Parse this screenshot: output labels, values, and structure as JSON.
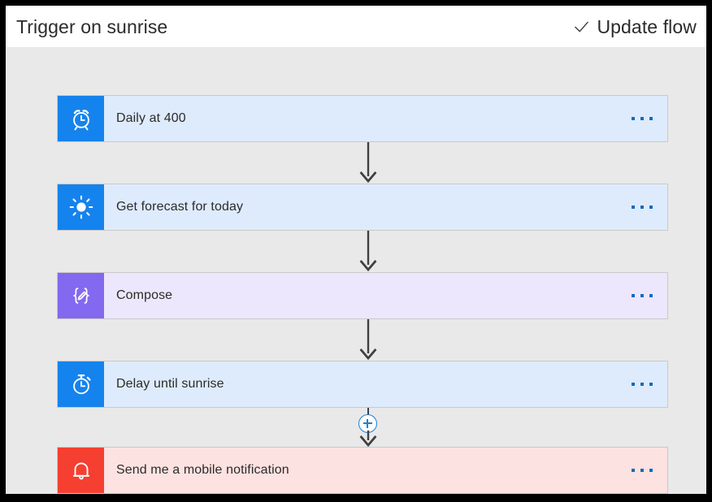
{
  "header": {
    "title": "Trigger on sunrise",
    "update_flow_label": "Update flow",
    "check_icon": "check-icon"
  },
  "colors": {
    "canvas_bg": "#e9e9e9",
    "header_bg": "#ffffff",
    "frame": "#000000",
    "card_blue_bg": "#deebfc",
    "card_blue_icon": "#1583ed",
    "card_purple_bg": "#ede7fd",
    "card_purple_icon": "#8269ef",
    "card_red_bg": "#fce2e0",
    "card_red_icon": "#f43f31",
    "card_border": "#c9c9c9",
    "connector": "#404040",
    "accent_blue": "#0f6cbd",
    "add_button_blue": "#1b7fd6",
    "text": "#2b2b2b"
  },
  "flow": {
    "steps": [
      {
        "title": "Daily at 400",
        "icon": "alarm-clock-icon",
        "theme": "blue",
        "menu_label": "..."
      },
      {
        "title": "Get forecast for today",
        "icon": "sun-icon",
        "theme": "blue",
        "menu_label": "..."
      },
      {
        "title": "Compose",
        "icon": "compose-braces-pencil-icon",
        "theme": "purple",
        "menu_label": "..."
      },
      {
        "title": "Delay until sunrise",
        "icon": "stopwatch-icon",
        "theme": "blue",
        "menu_label": "..."
      },
      {
        "title": "Send me a mobile notification",
        "icon": "bell-icon",
        "theme": "red",
        "menu_label": "..."
      }
    ],
    "add_step_icon": "plus-icon",
    "connector_icon": "arrow-down-icon"
  }
}
